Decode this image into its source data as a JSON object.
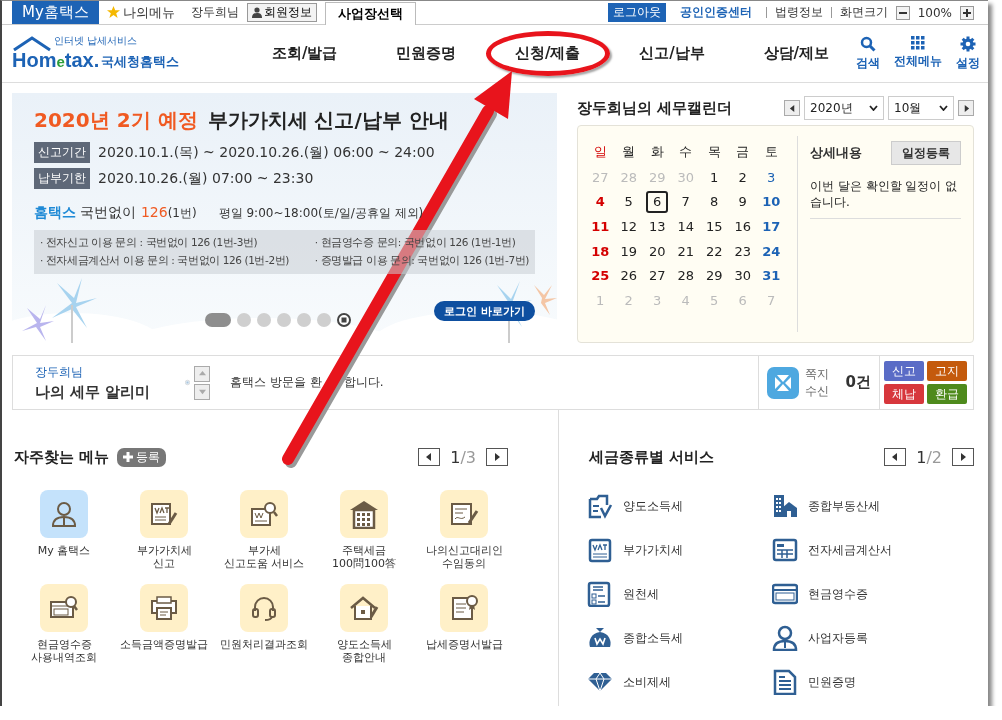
{
  "top_bar": {
    "my_hometax": "My홈택스",
    "my_menu": "나의메뉴",
    "user": "장두희님",
    "member_info": "회원정보",
    "workplace_tab": "사업장선택",
    "logout": "로그아웃",
    "cert_center": "공인인증센터",
    "law_info": "법령정보",
    "screen_size": "화면크기",
    "zoom": "100%"
  },
  "header": {
    "logo": {
      "tagline": "인터넷 납세서비스",
      "word_start": "Hom",
      "word_mid": "e",
      "word_end": "tax.",
      "subtitle": "국세청홈택스"
    },
    "nav": [
      {
        "label": "조회/발급",
        "annotated": false
      },
      {
        "label": "민원증명",
        "annotated": false
      },
      {
        "label": "신청/제출",
        "annotated": true
      },
      {
        "label": "신고/납부",
        "annotated": false
      },
      {
        "label": "상담/제보",
        "annotated": false
      }
    ],
    "tools": [
      {
        "kind": "search",
        "label": "검색"
      },
      {
        "kind": "grid",
        "label": "전체메뉴"
      },
      {
        "kind": "gear",
        "label": "설정"
      }
    ]
  },
  "banner": {
    "title_highlight": "2020년 2기 예정",
    "title": "부가가치세 신고/납부 안내",
    "periods": [
      {
        "tag": "신고기간",
        "text": "2020.10.1.(목) ~ 2020.10.26.(월) 06:00 ~ 24:00"
      },
      {
        "tag": "납부기한",
        "text": "2020.10.26.(월) 07:00 ~ 23:30"
      }
    ],
    "phone": {
      "brand": "홈택스",
      "prefix": "국번없이",
      "number": "126",
      "suffix": "(1번)",
      "hours": "평일 9:00~18:00(토/일/공휴일 제외)"
    },
    "inquiries": [
      "· 전자신고 이용 문의 : 국번없이 126 (1번-3번)",
      "· 현금영수증 문의: 국번없이 126 (1번-1번)",
      "· 전자세금계산서 이용 문의 : 국번없이 126 (1번-2번)",
      "· 증명발급 이용 문의: 국번없이 126 (1번-7번)"
    ],
    "slides": [
      {
        "selected": true
      },
      {
        "selected": false
      },
      {
        "selected": false
      },
      {
        "selected": false
      },
      {
        "selected": false
      },
      {
        "selected": false
      }
    ],
    "login_button": "로그인 바로가기"
  },
  "calendar": {
    "title": "장두희님의 세무캘린더",
    "year": "2020년",
    "month": "10월",
    "weekdays": [
      "일",
      "월",
      "화",
      "수",
      "목",
      "금",
      "토"
    ],
    "days": [
      {
        "n": "27",
        "muted": true,
        "today": false
      },
      {
        "n": "28",
        "muted": true,
        "today": false
      },
      {
        "n": "29",
        "muted": true,
        "today": false
      },
      {
        "n": "30",
        "muted": true,
        "today": false
      },
      {
        "n": "1",
        "muted": false,
        "today": false
      },
      {
        "n": "2",
        "muted": false,
        "today": false
      },
      {
        "n": "3",
        "muted": false,
        "today": false
      },
      {
        "n": "4",
        "muted": false,
        "today": false
      },
      {
        "n": "5",
        "muted": false,
        "today": false
      },
      {
        "n": "6",
        "muted": false,
        "today": true
      },
      {
        "n": "7",
        "muted": false,
        "today": false
      },
      {
        "n": "8",
        "muted": false,
        "today": false
      },
      {
        "n": "9",
        "muted": false,
        "today": false
      },
      {
        "n": "10",
        "muted": false,
        "today": false
      },
      {
        "n": "11",
        "muted": false,
        "today": false
      },
      {
        "n": "12",
        "muted": false,
        "today": false
      },
      {
        "n": "13",
        "muted": false,
        "today": false
      },
      {
        "n": "14",
        "muted": false,
        "today": false
      },
      {
        "n": "15",
        "muted": false,
        "today": false
      },
      {
        "n": "16",
        "muted": false,
        "today": false
      },
      {
        "n": "17",
        "muted": false,
        "today": false
      },
      {
        "n": "18",
        "muted": false,
        "today": false
      },
      {
        "n": "19",
        "muted": false,
        "today": false
      },
      {
        "n": "20",
        "muted": false,
        "today": false
      },
      {
        "n": "21",
        "muted": false,
        "today": false
      },
      {
        "n": "22",
        "muted": false,
        "today": false
      },
      {
        "n": "23",
        "muted": false,
        "today": false
      },
      {
        "n": "24",
        "muted": false,
        "today": false
      },
      {
        "n": "25",
        "muted": false,
        "today": false
      },
      {
        "n": "26",
        "muted": false,
        "today": false
      },
      {
        "n": "27",
        "muted": false,
        "today": false
      },
      {
        "n": "28",
        "muted": false,
        "today": false
      },
      {
        "n": "29",
        "muted": false,
        "today": false
      },
      {
        "n": "30",
        "muted": false,
        "today": false
      },
      {
        "n": "31",
        "muted": false,
        "today": false
      },
      {
        "n": "1",
        "muted": true,
        "today": false
      },
      {
        "n": "2",
        "muted": true,
        "today": false
      },
      {
        "n": "3",
        "muted": true,
        "today": false
      },
      {
        "n": "4",
        "muted": true,
        "today": false
      },
      {
        "n": "5",
        "muted": true,
        "today": false
      },
      {
        "n": "6",
        "muted": true,
        "today": false
      },
      {
        "n": "7",
        "muted": true,
        "today": false
      }
    ],
    "detail_title": "상세내용",
    "add_button": "일정등록",
    "empty_message": "이번 달은 확인할 일정이 없습니다."
  },
  "alimi": {
    "user": "장두희님",
    "title": "나의 세무 알리미",
    "message_parts": [
      "홈택스 방문을 환",
      "합니다."
    ],
    "note_label": [
      "쪽지",
      "수신"
    ],
    "note_count": "0건",
    "badges": [
      {
        "label": "신고",
        "color": "#5a6cc6"
      },
      {
        "label": "고지",
        "color": "#c45a0c"
      },
      {
        "label": "체납",
        "color": "#d7373c"
      },
      {
        "label": "환급",
        "color": "#4e8a1c"
      }
    ]
  },
  "frequent_menu": {
    "title": "자주찾는 메뉴",
    "add_button": "등록",
    "page": "1",
    "pages": "/3",
    "items": [
      {
        "lines": [
          "My 홈택스"
        ],
        "color": "#c4e2fb"
      },
      {
        "lines": [
          "부가가치세",
          "신고"
        ],
        "color": "#fff0c8"
      },
      {
        "lines": [
          "부가세",
          "신고도움 서비스"
        ],
        "color": "#fff0c8"
      },
      {
        "lines": [
          "주택세금",
          "100問100答"
        ],
        "color": "#fff0c8"
      },
      {
        "lines": [
          "나의신고대리인",
          "수임동의"
        ],
        "color": "#fff0c8"
      },
      {
        "lines": [
          "현금영수증",
          "사용내역조회"
        ],
        "color": "#fff0c8"
      },
      {
        "lines": [
          "소득금액증명발급"
        ],
        "color": "#fff0c8"
      },
      {
        "lines": [
          "민원처리결과조회"
        ],
        "color": "#fff0c8"
      },
      {
        "lines": [
          "양도소득세",
          "종합안내"
        ],
        "color": "#fff0c8"
      },
      {
        "lines": [
          "납세증명서발급"
        ],
        "color": "#fff0c8"
      }
    ]
  },
  "tax_services": {
    "title": "세금종류별 서비스",
    "page": "1",
    "pages": "/2",
    "items": [
      "양도소득세",
      "종합부동산세",
      "부가가치세",
      "전자세금계산서",
      "원천세",
      "현금영수증",
      "종합소득세",
      "사업자등록",
      "소비제세",
      "민원증명"
    ]
  }
}
